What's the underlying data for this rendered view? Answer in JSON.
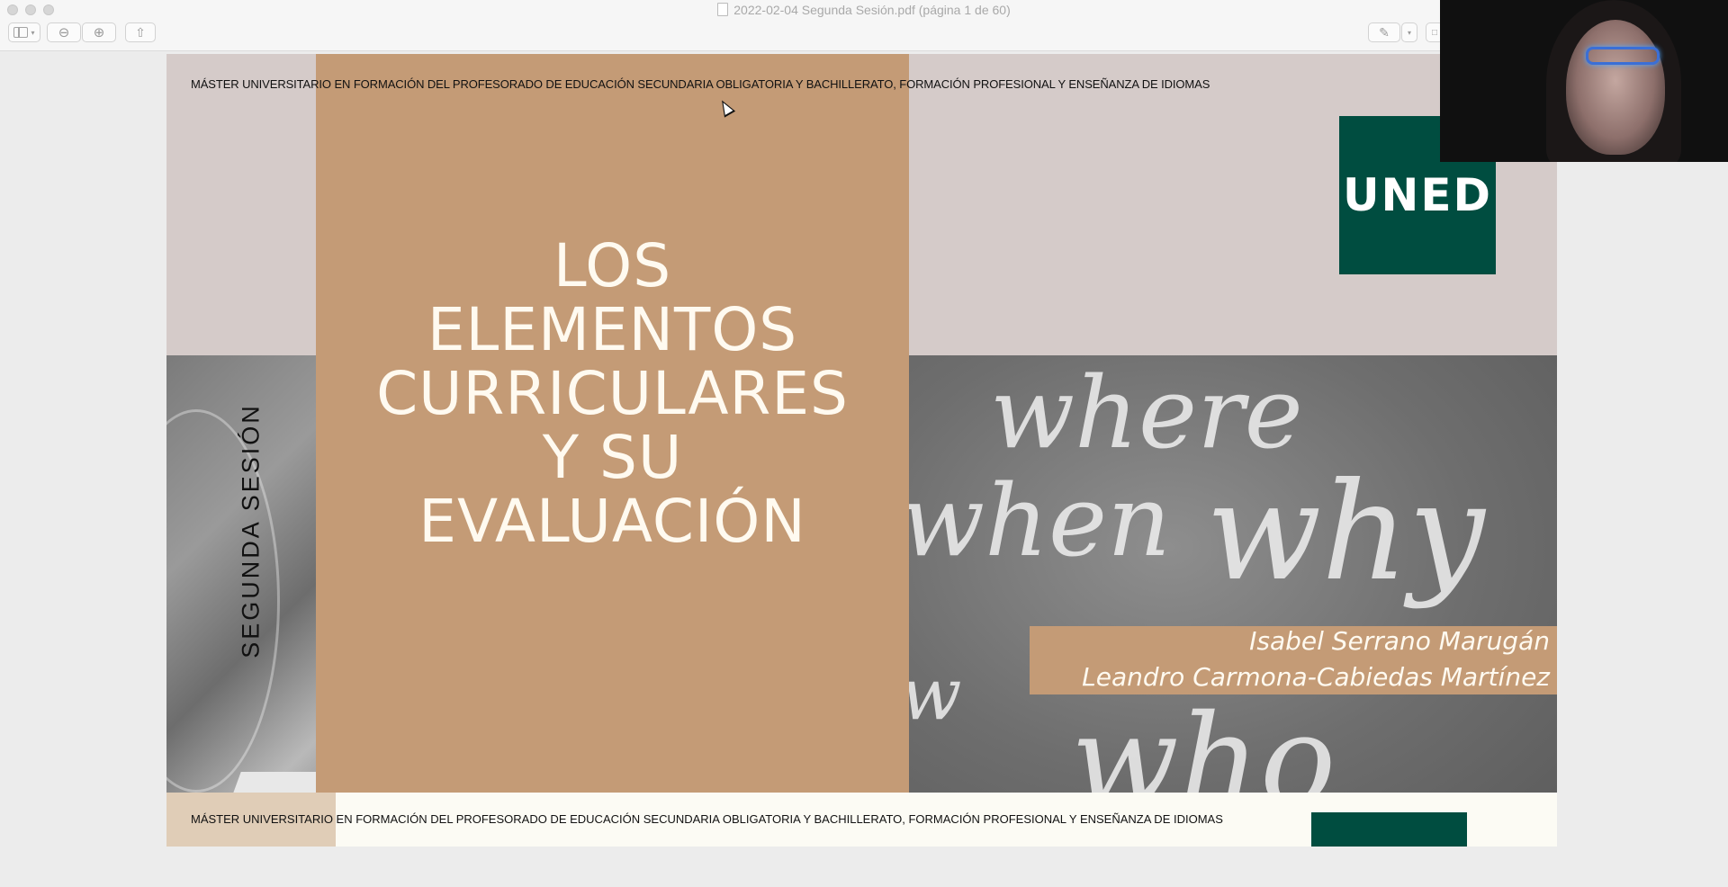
{
  "window": {
    "title": "2022-02-04 Segunda Sesión.pdf (página 1 de 60)"
  },
  "toolbar": {
    "icons": [
      "sidebar-icon",
      "chevron-down-icon",
      "zoom-out-icon",
      "zoom-in-icon",
      "share-icon",
      "markup-pen-icon",
      "chevron-down-icon"
    ]
  },
  "slide1": {
    "header": "MÁSTER UNIVERSITARIO EN FORMACIÓN DEL PROFESORADO DE EDUCACIÓN SECUNDARIA OBLIGATORIA Y BACHILLERATO, FORMACIÓN PROFESIONAL Y ENSEÑANZA DE IDIOMAS",
    "vertical_label": "SEGUNDA SESIÓN",
    "title_lines": [
      "LOS",
      "ELEMENTOS",
      "CURRICULARES",
      "Y SU",
      "EVALUACIÓN"
    ],
    "logo": "UNED",
    "authors": [
      "Isabel Serrano Marugán",
      "Leandro Carmona-Cabiedas Martínez"
    ],
    "chalkboard_words": [
      "where",
      "when",
      "why",
      "w",
      "who"
    ],
    "colors": {
      "title_panel": "#c49b76",
      "background": "#d5cbc9",
      "logo": "#004d40"
    }
  },
  "slide2": {
    "header": "MÁSTER UNIVERSITARIO EN FORMACIÓN DEL PROFESORADO DE EDUCACIÓN SECUNDARIA OBLIGATORIA Y BACHILLERATO, FORMACIÓN PROFESIONAL Y ENSEÑANZA DE IDIOMAS"
  }
}
